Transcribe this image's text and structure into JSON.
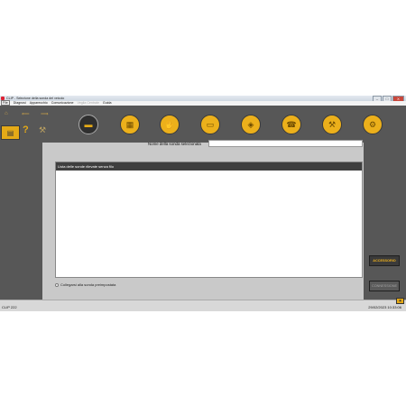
{
  "window": {
    "title": "CLIP - Selezione della sonda del veicolo",
    "controls": {
      "minimize": "–",
      "maximize": "□",
      "close": "X"
    }
  },
  "menubar": {
    "items": [
      {
        "label": "File",
        "enabled": true
      },
      {
        "label": "Diagnosi",
        "enabled": true
      },
      {
        "label": "Apparecchio",
        "enabled": true
      },
      {
        "label": "Comunicazione",
        "enabled": true
      },
      {
        "label": "Veglia Centrale",
        "enabled": false
      },
      {
        "label": "Guida",
        "enabled": true
      }
    ]
  },
  "toolbar": {
    "left_icons": [
      "home-icon",
      "back-arrow-icon",
      "forward-arrow-icon",
      "main-module-icon",
      "help-icon",
      "tool-icon"
    ],
    "help_glyph": "?",
    "icons": [
      {
        "name": "probe-icon",
        "glyph": "▬",
        "active": true
      },
      {
        "name": "grid-icon",
        "glyph": "▦",
        "active": false
      },
      {
        "name": "hand-icon",
        "glyph": "✋",
        "active": false
      },
      {
        "name": "battery-icon",
        "glyph": "▭",
        "active": false
      },
      {
        "name": "car-icon",
        "glyph": "◈",
        "active": false
      },
      {
        "name": "phone-icon",
        "glyph": "☎",
        "active": false
      },
      {
        "name": "wrench-icon",
        "glyph": "⚒",
        "active": false
      },
      {
        "name": "gear-person-icon",
        "glyph": "⚙",
        "active": false
      }
    ],
    "accent_color": "#ecb01b"
  },
  "form": {
    "probe_name_label": "Nome della sonda selezionata",
    "probe_name_value": "",
    "list_header": "Lista delle sonde rilevate senza filo",
    "list_items": [],
    "radio_label": "Collegarsi alla sonda preimpostata",
    "accept_button": "ACCESSORIO",
    "connect_button": "CONNESSIONE"
  },
  "statusbar": {
    "left": "CLIP 222",
    "right": "29/02/2023 10:33:06"
  }
}
